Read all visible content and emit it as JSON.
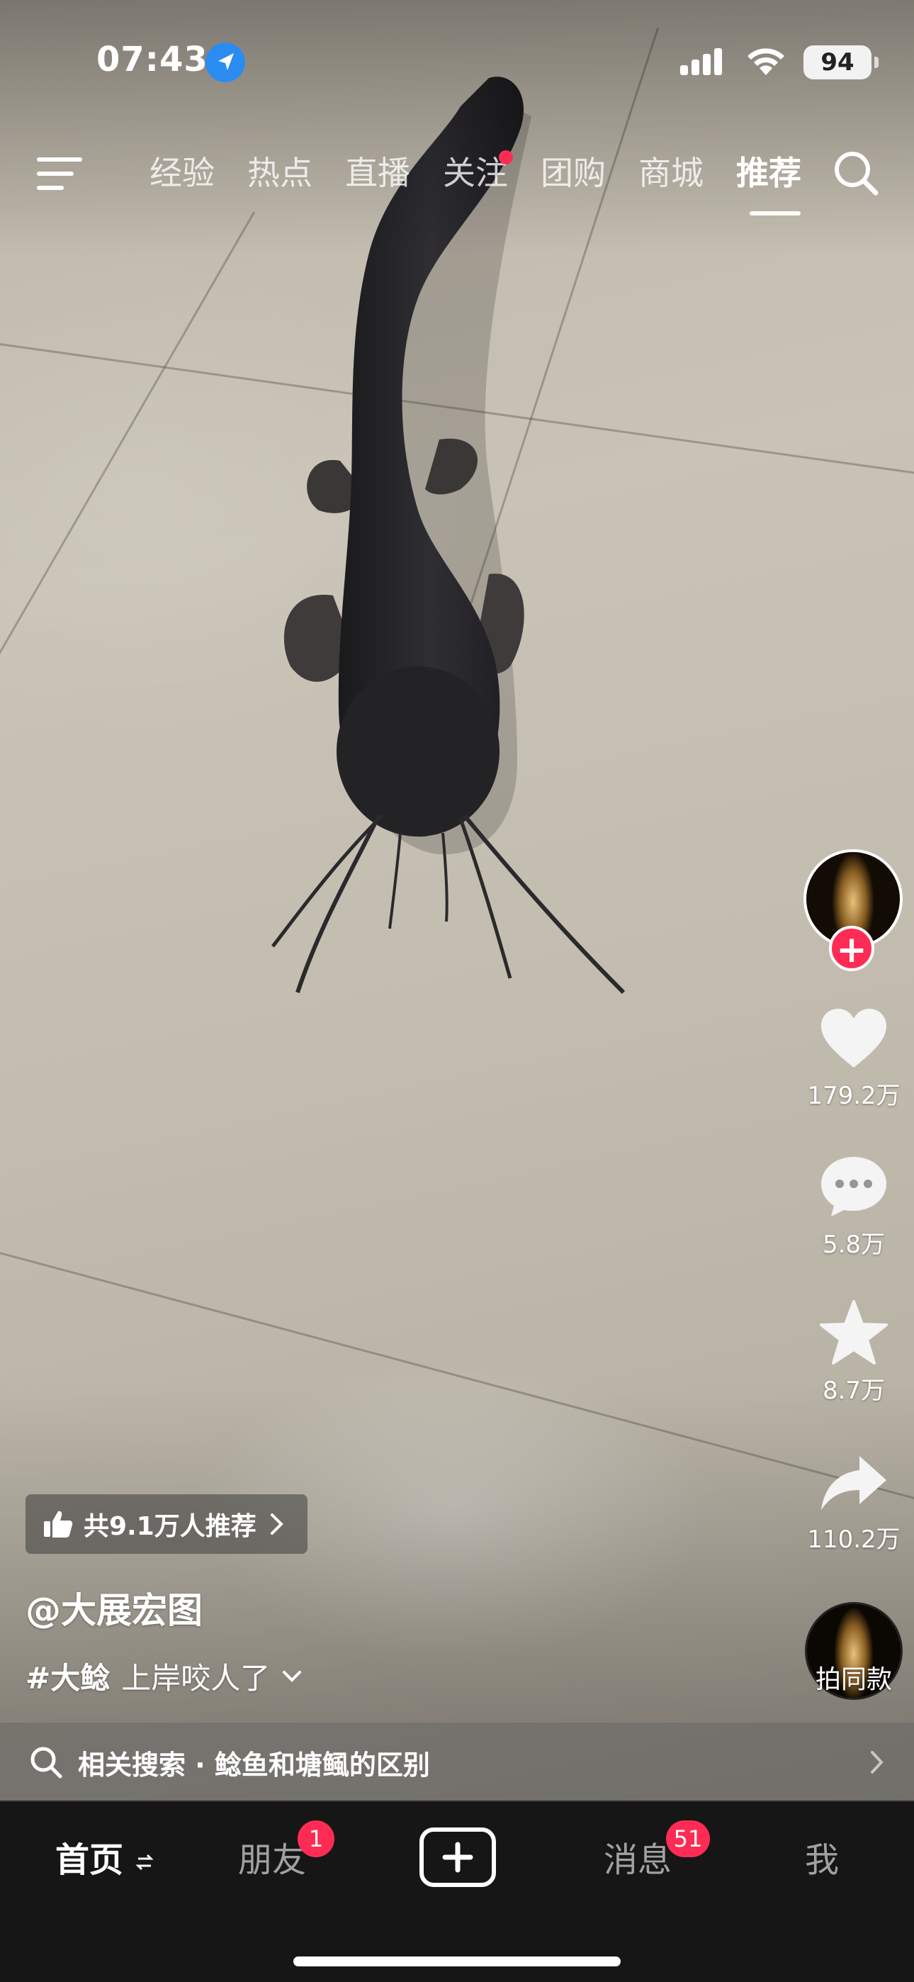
{
  "status_bar": {
    "time": "07:43",
    "battery": "94"
  },
  "top_nav": {
    "tabs": [
      {
        "label": "经验",
        "active": false,
        "dot": false
      },
      {
        "label": "热点",
        "active": false,
        "dot": false
      },
      {
        "label": "直播",
        "active": false,
        "dot": false
      },
      {
        "label": "关注",
        "active": false,
        "dot": true
      },
      {
        "label": "团购",
        "active": false,
        "dot": false
      },
      {
        "label": "商城",
        "active": false,
        "dot": false
      },
      {
        "label": "推荐",
        "active": true,
        "dot": false
      }
    ]
  },
  "actions": {
    "likes": "179.2万",
    "comments": "5.8万",
    "favorites": "8.7万",
    "shares": "110.2万",
    "music_label": "拍同款"
  },
  "caption": {
    "recommend_text": "共9.1万人推荐",
    "author": "@大展宏图",
    "hashtag": "#大鲶",
    "description": "上岸咬人了"
  },
  "related_search": {
    "text": "相关搜索 · 鲶鱼和塘鲺的区别"
  },
  "bottom_tabs": {
    "home": "首页",
    "friends": "朋友",
    "friends_badge": "1",
    "messages": "消息",
    "messages_badge": "51",
    "me": "我"
  },
  "colors": {
    "accent": "#fe2c55",
    "location": "#2a8cf0",
    "tabbar": "#161616"
  }
}
